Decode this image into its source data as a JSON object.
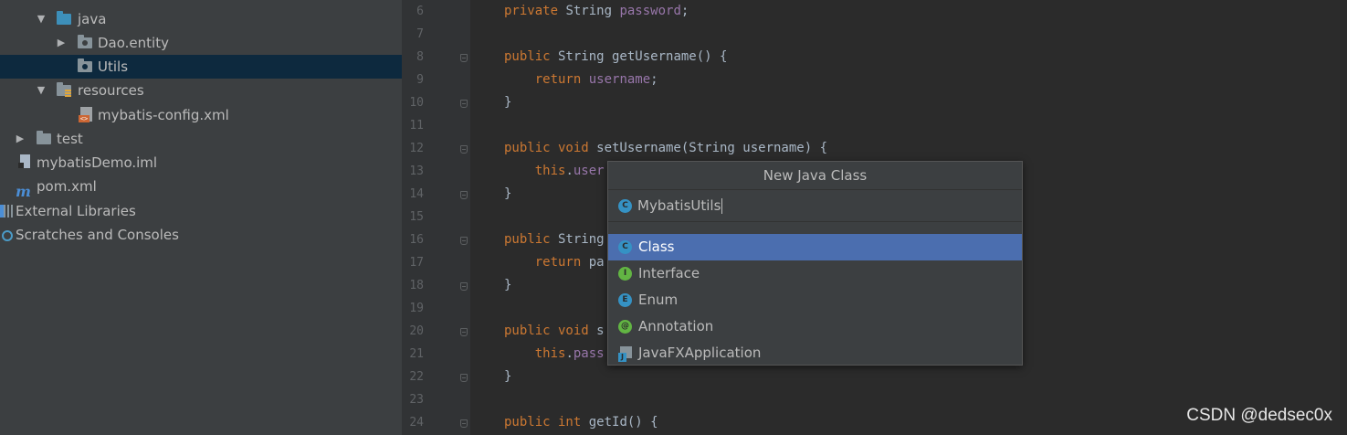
{
  "project_tree": {
    "items": [
      {
        "label": "java",
        "icon": "source-folder-icon"
      },
      {
        "label": "Dao.entity",
        "icon": "package-icon"
      },
      {
        "label": "Utils",
        "icon": "package-icon"
      },
      {
        "label": "resources",
        "icon": "resources-folder-icon"
      },
      {
        "label": "mybatis-config.xml",
        "icon": "xml-file-icon"
      },
      {
        "label": "test",
        "icon": "folder-icon"
      },
      {
        "label": "mybatisDemo.iml",
        "icon": "iml-file-icon"
      },
      {
        "label": "pom.xml",
        "icon": "maven-icon"
      },
      {
        "label": "External Libraries",
        "icon": "library-icon"
      },
      {
        "label": "Scratches and Consoles",
        "icon": "scratches-icon"
      }
    ],
    "selected": "Utils"
  },
  "editor": {
    "line_numbers": [
      "6",
      "7",
      "8",
      "9",
      "10",
      "11",
      "12",
      "13",
      "14",
      "15",
      "16",
      "17",
      "18",
      "19",
      "20",
      "21",
      "22",
      "23",
      "24"
    ]
  },
  "dialog": {
    "title": "New Java Class",
    "name_value": "MybatisUtils",
    "kinds": [
      "Class",
      "Interface",
      "Enum",
      "Annotation",
      "JavaFXApplication"
    ],
    "selected_kind": "Class"
  },
  "watermark": "CSDN @dedsec0x",
  "colors": {
    "tree_bg": "#3c3f41",
    "editor_bg": "#2b2b2b",
    "selection": "#4b6eaf",
    "keyword": "#cc7832",
    "field": "#9876aa"
  }
}
